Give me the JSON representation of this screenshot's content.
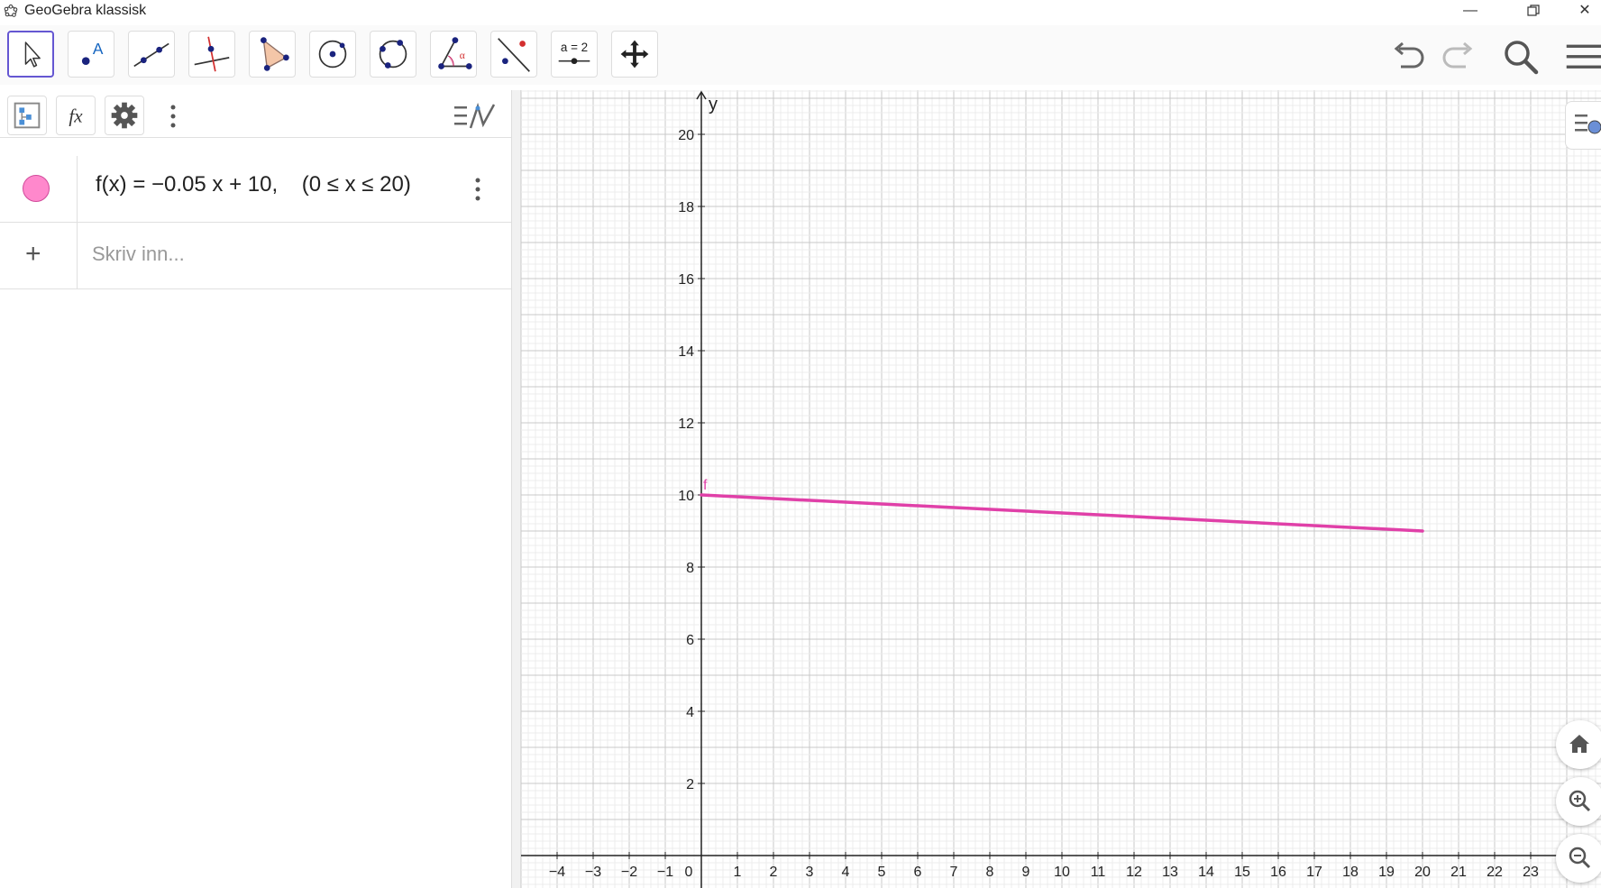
{
  "window": {
    "title": "GeoGebra klassisk",
    "controls": [
      "minimize-icon",
      "restore-icon",
      "close-icon"
    ]
  },
  "toolbar": {
    "tools": [
      {
        "name": "move-tool",
        "icon": "arrow-cursor-icon",
        "active": true
      },
      {
        "name": "point-tool",
        "icon": "point-icon",
        "label": "A"
      },
      {
        "name": "line-tool",
        "icon": "line-through-points-icon"
      },
      {
        "name": "perpendicular-line-tool",
        "icon": "perpendicular-line-icon"
      },
      {
        "name": "polygon-tool",
        "icon": "polygon-icon"
      },
      {
        "name": "circle-center-point-tool",
        "icon": "circle-center-icon"
      },
      {
        "name": "circle-three-points-tool",
        "icon": "circle-three-points-icon"
      },
      {
        "name": "angle-tool",
        "icon": "angle-icon",
        "label": "α"
      },
      {
        "name": "reflect-tool",
        "icon": "reflect-line-icon"
      },
      {
        "name": "slider-tool",
        "icon": "slider-icon",
        "label": "a = 2"
      },
      {
        "name": "move-graphics-tool",
        "icon": "move-arrows-icon"
      }
    ],
    "right": [
      "undo-icon",
      "redo-icon",
      "search-icon",
      "hamburger-menu-icon"
    ]
  },
  "algebra": {
    "header_buttons": [
      "algebra-view-icon",
      "fx-icon",
      "gear-icon",
      "more-vertical-icon"
    ],
    "fx_label": "fx",
    "rows": [
      {
        "formula": "f(x) = −0.05 x + 10,    (0 ≤ x ≤ 20)",
        "color": "#ff88cc"
      }
    ],
    "input_placeholder": "Skriv inn..."
  },
  "graphics": {
    "axis_label_y": "y",
    "curve_label": "f",
    "curve_color": "#e040a8",
    "x_ticks": [
      "−4",
      "−3",
      "−2",
      "−1",
      "0",
      "1",
      "2",
      "3",
      "4",
      "5",
      "6",
      "7",
      "8",
      "9",
      "10",
      "11",
      "12",
      "13",
      "14",
      "15",
      "16",
      "17",
      "18",
      "19",
      "20",
      "21",
      "22",
      "23"
    ],
    "y_ticks": [
      "2",
      "4",
      "6",
      "8",
      "10",
      "12",
      "14",
      "16",
      "18",
      "20"
    ],
    "function": {
      "slope": -0.05,
      "intercept": 10,
      "x_min": 0,
      "x_max": 20
    },
    "x_range": [
      -5,
      23.6
    ],
    "y_range": [
      0,
      21.2
    ],
    "nav_buttons": [
      "home-icon",
      "zoom-in-icon",
      "zoom-out-icon"
    ]
  }
}
